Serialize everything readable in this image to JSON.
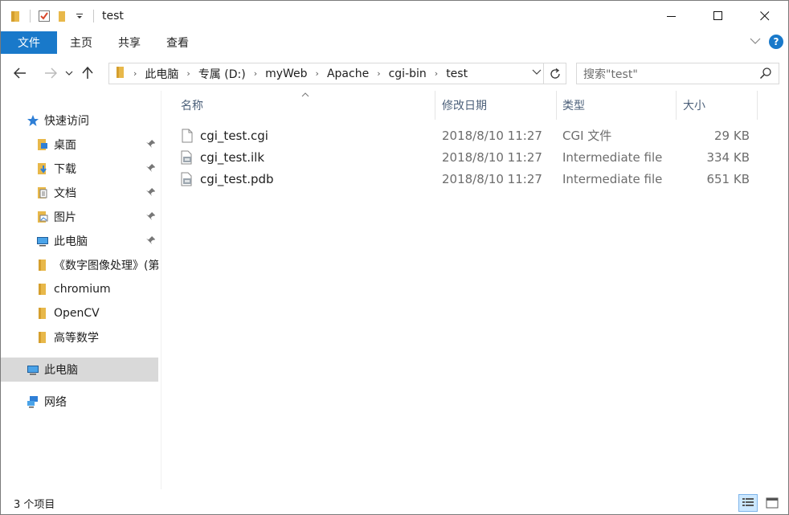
{
  "window": {
    "title": "test",
    "controls": {
      "minimize": "—",
      "maximize": "☐",
      "close": "✕"
    }
  },
  "ribbon": {
    "tabs": [
      "文件",
      "主页",
      "共享",
      "查看"
    ],
    "help": "?"
  },
  "address": {
    "crumbs": [
      "此电脑",
      "专属 (D:)",
      "myWeb",
      "Apache",
      "cgi-bin",
      "test"
    ],
    "search_placeholder": "搜索\"test\""
  },
  "navpane": {
    "quick_access": "快速访问",
    "items": [
      {
        "label": "桌面",
        "icon": "desktop-icon",
        "pinned": true
      },
      {
        "label": "下载",
        "icon": "download-icon",
        "pinned": true
      },
      {
        "label": "文档",
        "icon": "documents-icon",
        "pinned": true
      },
      {
        "label": "图片",
        "icon": "pictures-icon",
        "pinned": true
      },
      {
        "label": "此电脑",
        "icon": "computer-icon",
        "pinned": true
      },
      {
        "label": "《数字图像处理》(第",
        "icon": "folder-icon",
        "pinned": false
      },
      {
        "label": "chromium",
        "icon": "folder-icon",
        "pinned": false
      },
      {
        "label": "OpenCV",
        "icon": "folder-icon",
        "pinned": false
      },
      {
        "label": "高等数学",
        "icon": "folder-icon",
        "pinned": false
      }
    ],
    "this_pc": "此电脑",
    "network": "网络"
  },
  "filelist": {
    "columns": {
      "name": "名称",
      "date": "修改日期",
      "type": "类型",
      "size": "大小"
    },
    "rows": [
      {
        "name": "cgi_test.cgi",
        "date": "2018/8/10 11:27",
        "type": "CGI 文件",
        "size": "29 KB",
        "icon": "file-icon"
      },
      {
        "name": "cgi_test.ilk",
        "date": "2018/8/10 11:27",
        "type": "Intermediate file",
        "size": "334 KB",
        "icon": "system-file-icon"
      },
      {
        "name": "cgi_test.pdb",
        "date": "2018/8/10 11:27",
        "type": "Intermediate file",
        "size": "651 KB",
        "icon": "system-file-icon"
      }
    ]
  },
  "status": {
    "count": "3 个项目"
  },
  "colors": {
    "accent": "#1979ca",
    "folder": "#e8b84a",
    "selected": "#d9d9d9"
  }
}
